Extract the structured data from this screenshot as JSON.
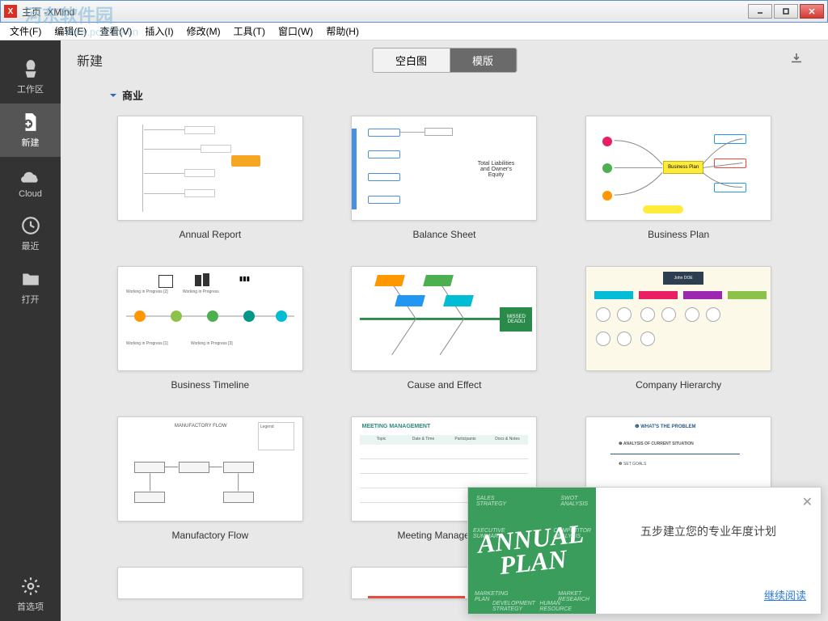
{
  "window": {
    "title": "主页 -XMind"
  },
  "watermark": {
    "text": "河东软件园",
    "url": "www.pc0359.cn"
  },
  "menu": {
    "file": "文件(F)",
    "edit": "编辑(E)",
    "view": "查看(V)",
    "insert": "插入(I)",
    "modify": "修改(M)",
    "tools": "工具(T)",
    "window": "窗口(W)",
    "help": "帮助(H)"
  },
  "sidebar": {
    "workspace": "工作区",
    "new": "新建",
    "cloud": "Cloud",
    "recent": "最近",
    "open": "打开",
    "preferences": "首选项"
  },
  "content": {
    "title": "新建",
    "tab_blank": "空白图",
    "tab_template": "模版",
    "category": "商业"
  },
  "templates": [
    {
      "label": "Annual Report"
    },
    {
      "label": "Balance Sheet"
    },
    {
      "label": "Business Plan"
    },
    {
      "label": "Business Timeline"
    },
    {
      "label": "Cause and Effect"
    },
    {
      "label": "Company Hierarchy"
    },
    {
      "label": "Manufactory Flow"
    },
    {
      "label": "Meeting Management"
    },
    {
      "label": ""
    }
  ],
  "popup": {
    "image_headline_1": "ANNUAL",
    "image_headline_2": "PLAN",
    "title": "五步建立您的专业年度计划",
    "link": "继续阅读"
  }
}
